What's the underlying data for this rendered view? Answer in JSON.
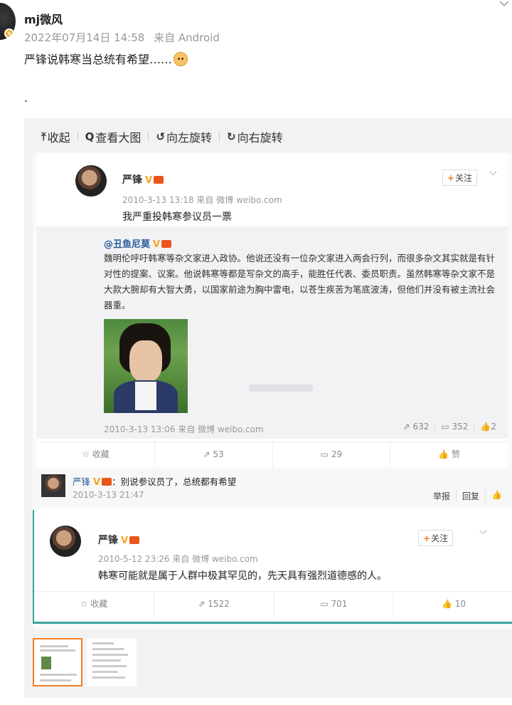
{
  "post": {
    "username": "mj微风",
    "date": "2022年07月14日 14:58",
    "source": "来自 Android",
    "text": "严锋说韩寒当总统有希望……",
    "second_line": "."
  },
  "toolbar": {
    "collapse": "收起",
    "view_large": "查看大图",
    "rotate_left": "向左旋转",
    "rotate_right": "向右旋转"
  },
  "screenshot": {
    "post1": {
      "author": "严锋",
      "time": "2010-3-13 13:18 来自 微博 weibo.com",
      "text": "我严重投韩寒参议员一票",
      "follow": "关注",
      "repost": {
        "author": "@丑鱼尼莫",
        "text": "魏明伦呼吁韩寒等杂文家进入政协。他说还没有一位杂文家进入两会行列，而很多杂文其实就是有针对性的提案、议案。他说韩寒等都是写杂文的高手，能胜任代表、委员职责。虽然韩寒等杂文家不是大款大腕却有大智大勇，以国家前途为胸中雷电，以苍生疾苦为笔底波涛，但他们并没有被主流社会器重。",
        "time": "2010-3-13 13:06 来自 微博 weibo.com",
        "stats": {
          "forward": "632",
          "comment": "352",
          "like": "2"
        }
      },
      "actions": {
        "fav": "收藏",
        "forward": "53",
        "comment": "29",
        "like": "赞"
      }
    },
    "comment": {
      "author": "严锋",
      "text": "：别说参议员了，总统都有希望",
      "time": "2010-3-13 21:47",
      "report": "举报",
      "reply": "回复"
    },
    "post2": {
      "author": "严锋",
      "time": "2010-5-12 23:26 来自 微博 weibo.com",
      "text": "韩寒可能就是属于人群中极其罕见的，先天具有强烈道德感的人。",
      "follow": "关注",
      "actions": {
        "fav": "收藏",
        "forward": "1522",
        "comment": "701",
        "like": "10"
      }
    }
  },
  "colors": {
    "accent": "#f77c20",
    "link": "#2a5a99",
    "verified": "#f5a623"
  }
}
